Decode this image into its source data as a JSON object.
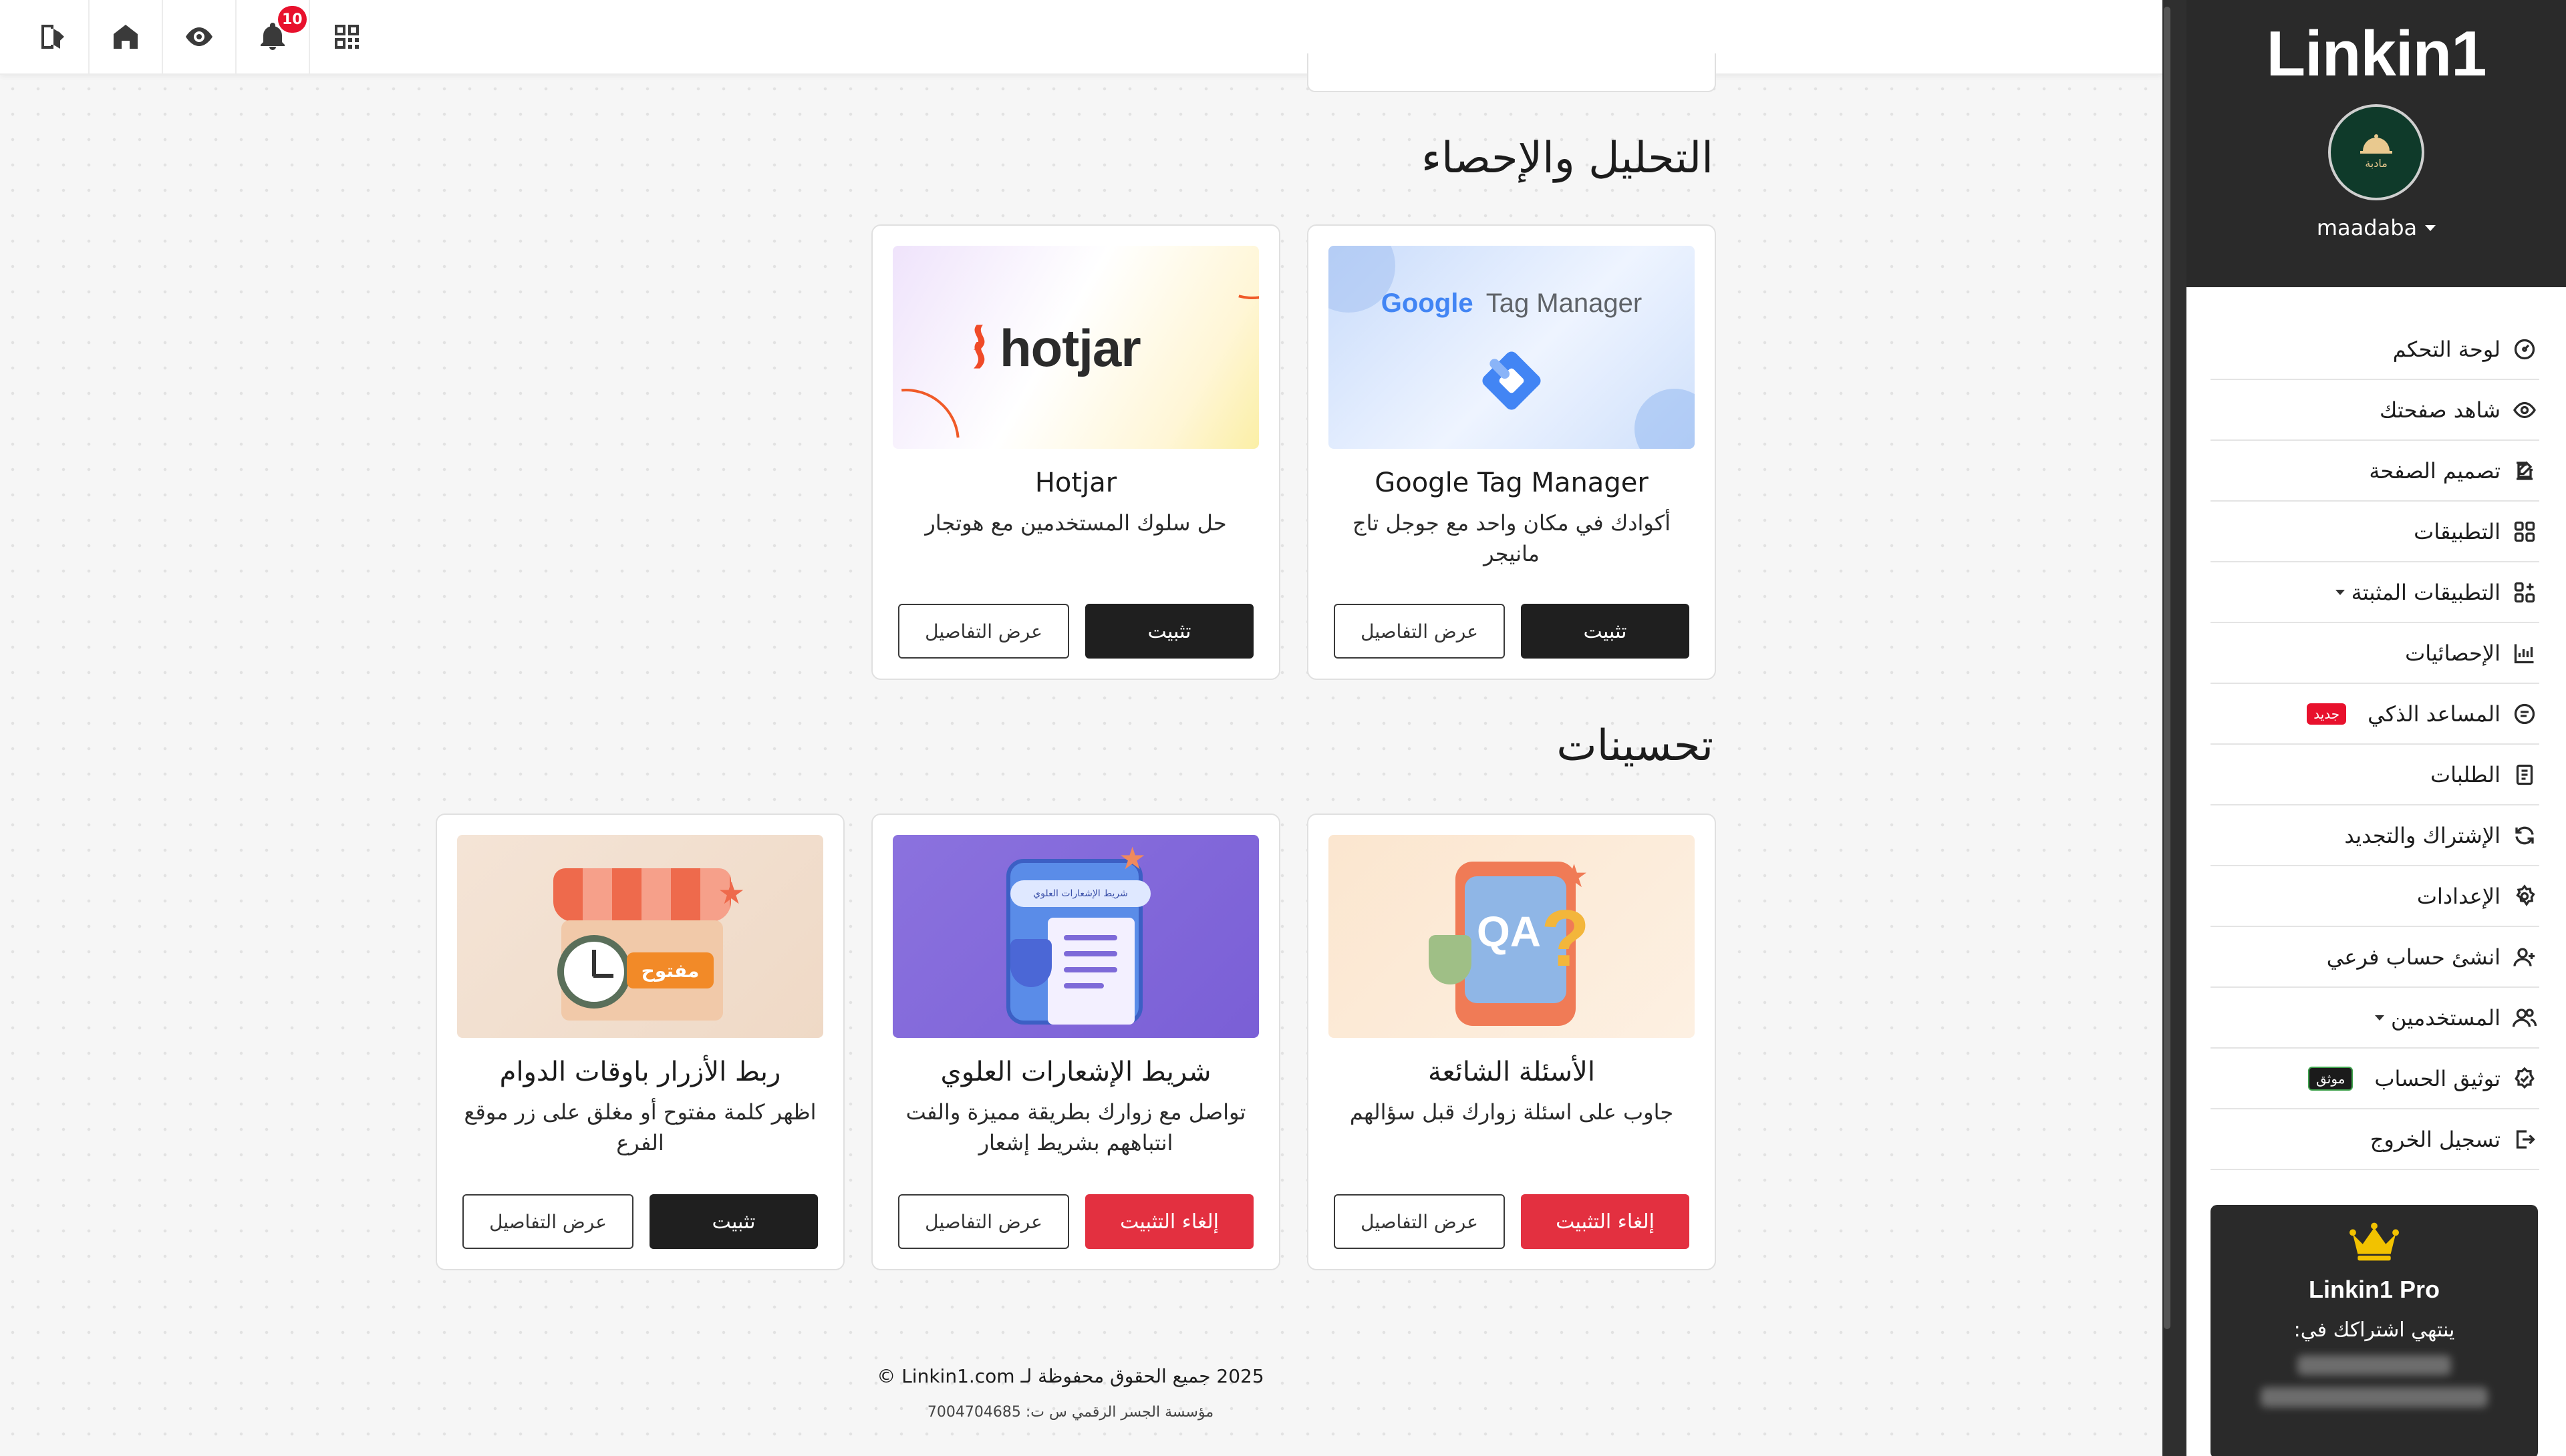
{
  "toolbar": {
    "notifications_count": "10",
    "icons": [
      "logout-icon",
      "home-icon",
      "eye-icon",
      "bell-icon",
      "qr-code-icon"
    ]
  },
  "sidebar": {
    "brand": "Linkin1",
    "account_name": "maadaba",
    "avatar_text": "مادبة",
    "items": [
      {
        "label": "لوحة التحكم",
        "icon": "dashboard-icon"
      },
      {
        "label": "شاهد صفحتك",
        "icon": "eye-icon"
      },
      {
        "label": "تصميم الصفحة",
        "icon": "edit-icon"
      },
      {
        "label": "التطبيقات",
        "icon": "apps-icon"
      },
      {
        "label": "التطبيقات المثبتة",
        "icon": "installed-apps-icon"
      },
      {
        "label": "الإحصائيات",
        "icon": "chart-icon"
      },
      {
        "label": "المساعد الذكي",
        "icon": "ai-icon",
        "tag": "جديد"
      },
      {
        "label": "الطلبات",
        "icon": "orders-icon"
      },
      {
        "label": "الإشتراك والتجديد",
        "icon": "refresh-icon"
      },
      {
        "label": "الإعدادات",
        "icon": "settings-icon"
      },
      {
        "label": "انشئ حساب فرعي",
        "icon": "add-user-icon"
      },
      {
        "label": "المستخدمين",
        "icon": "users-icon"
      },
      {
        "label": "توثيق الحساب",
        "icon": "verified-icon",
        "tag": "موثق"
      },
      {
        "label": "تسجيل الخروج",
        "icon": "logout-icon"
      }
    ],
    "pro": {
      "title": "Linkin1 Pro",
      "subtitle": "ينتهي اشتراكك في:"
    }
  },
  "main": {
    "sections": [
      {
        "title": "التحليل والإحصاء",
        "cards": [
          {
            "title": "Google Tag Manager",
            "description": "أكوادك في مكان واحد مع جوجل تاج مانيجر",
            "image_text": [
              "Google",
              "Tag Manager"
            ],
            "primary": "تثبيت",
            "secondary": "عرض التفاصيل"
          },
          {
            "title": "Hotjar",
            "description": "حل سلوك المستخدمين مع هوتجار",
            "image_text": [
              "hotjar"
            ],
            "primary": "تثبيت",
            "secondary": "عرض التفاصيل"
          }
        ]
      },
      {
        "title": "تحسينات",
        "cards": [
          {
            "title": "الأسئلة الشائعة",
            "description": "جاوب على اسئلة زوارك قبل سؤالهم",
            "image_text": [
              "QA"
            ],
            "primary": "إلغاء التثبيت",
            "secondary": "عرض التفاصيل"
          },
          {
            "title": "شريط الإشعارات العلوي",
            "description": "تواصل مع زوارك بطريقة مميزة والفت انتباههم بشريط إشعار",
            "image_text": [
              "شريط الإشعارات العلوي"
            ],
            "primary": "إلغاء التثبيت",
            "secondary": "عرض التفاصيل"
          },
          {
            "title": "ربط الأزرار باوقات الدوام",
            "description": "اظهر كلمة مفتوح أو مغلق على زر موقع الفرع",
            "image_text": [
              "مفتوح"
            ],
            "primary": "تثبيت",
            "secondary": "عرض التفاصيل"
          }
        ]
      }
    ]
  },
  "footer": {
    "copyright": "2025 جميع الحقوق محفوظة لـ Linkin1.com ©",
    "company": "مؤسسة الجسر الرقمي س ت: 7004704685"
  },
  "colors": {
    "dark": "#1f1f1f",
    "danger": "#e33040",
    "badge": "#e8112d",
    "sidebar_bg": "#2a2a2a",
    "crown": "#f2c200"
  }
}
